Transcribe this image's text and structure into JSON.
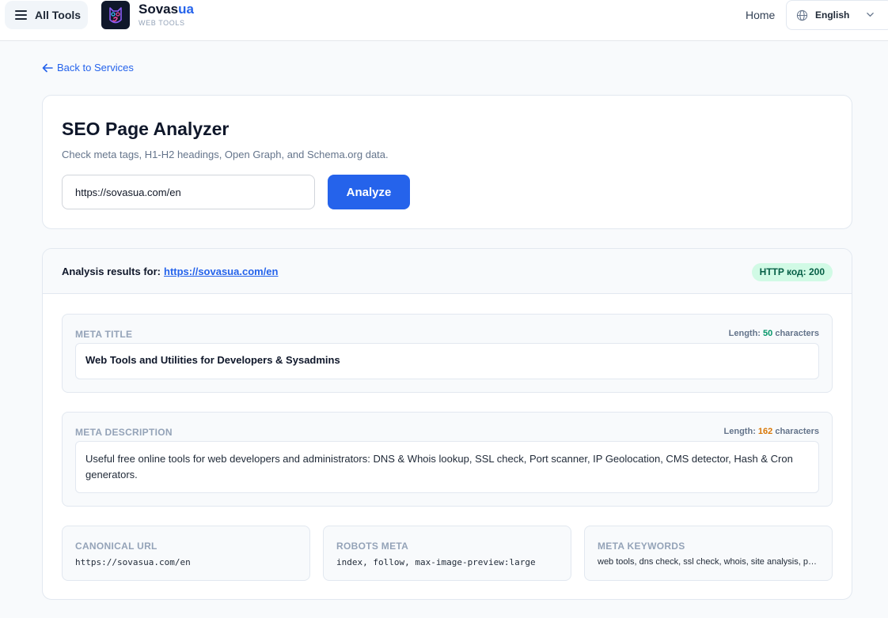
{
  "header": {
    "menu_label": "All Tools",
    "brand_name_main": "Sovas",
    "brand_name_accent": "ua",
    "brand_tagline": "WEB TOOLS",
    "nav_home": "Home",
    "language": "English"
  },
  "back_link": "Back to Services",
  "analyzer": {
    "title": "SEO Page Analyzer",
    "subtitle": "Check meta tags, H1-H2 headings, Open Graph, and Schema.org data.",
    "url_value": "https://sovasua.com/en",
    "analyze_label": "Analyze"
  },
  "results": {
    "label": "Analysis results for:",
    "url": "https://sovasua.com/en",
    "http_badge": "HTTP код: 200",
    "meta_title": {
      "label": "META TITLE",
      "length_prefix": "Length:",
      "length": "50",
      "length_suffix": "characters",
      "value": "Web Tools and Utilities for Developers & Sysadmins"
    },
    "meta_description": {
      "label": "META DESCRIPTION",
      "length_prefix": "Length:",
      "length": "162",
      "length_suffix": "characters",
      "value": "Useful free online tools for web developers and administrators: DNS & Whois lookup, SSL check, Port scanner, IP Geolocation, CMS detector, Hash & Cron generators."
    },
    "canonical": {
      "label": "CANONICAL URL",
      "value": "https://sovasua.com/en"
    },
    "robots": {
      "label": "ROBOTS META",
      "value": "index, follow, max-image-preview:large"
    },
    "keywords": {
      "label": "META KEYWORDS",
      "value": "web tools, dns check, ssl check, whois, site analysis, port scanner"
    }
  },
  "colors": {
    "accent": "#2563eb",
    "badge_bg": "#d1fae5",
    "length_ok": "#059669",
    "length_warn": "#d97706"
  },
  "icons": [
    "menu-icon",
    "owl-logo-icon",
    "globe-icon",
    "chevron-down-icon",
    "arrow-left-icon"
  ]
}
